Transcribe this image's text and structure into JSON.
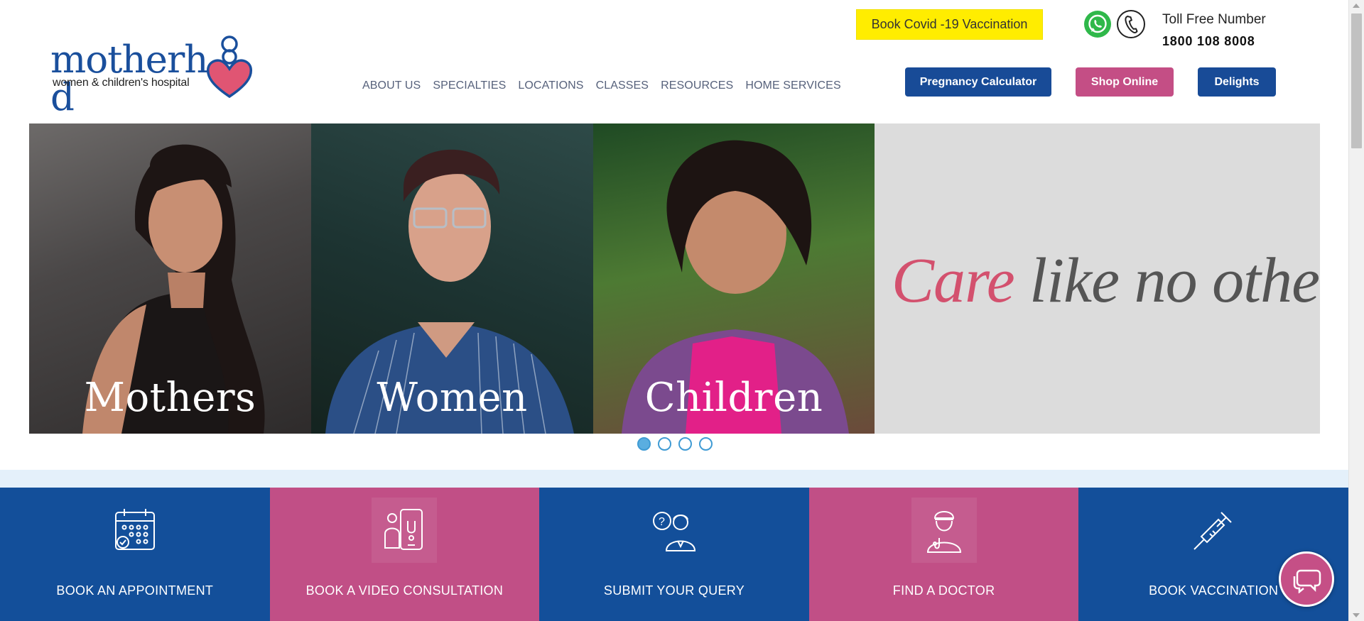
{
  "brand": {
    "wordmark": "motherhood",
    "wordmark_left": "motherh",
    "wordmark_right": "d",
    "subtitle": "women & children's hospital"
  },
  "nav": {
    "items": [
      "ABOUT US",
      "SPECIALTIES",
      "LOCATIONS",
      "CLASSES",
      "RESOURCES",
      "HOME SERVICES"
    ]
  },
  "header": {
    "covid_button": "Book Covid -19 Vaccination",
    "whatsapp_icon": "whatsapp-icon",
    "phone_icon": "phone-icon",
    "toll_free_label": "Toll Free Number",
    "toll_free_number": "1800 108 8008",
    "buttons": {
      "calculator": "Pregnancy Calculator",
      "shop": "Shop Online",
      "delights": "Delights"
    }
  },
  "hero": {
    "panels": [
      "Mothers",
      "Women",
      "Children"
    ],
    "tagline_accent": "Care",
    "tagline_rest": " like no other.",
    "slides_total": 4,
    "active_slide": 1
  },
  "tiles": [
    {
      "label": "BOOK AN APPOINTMENT",
      "icon": "calendar-icon",
      "color": "#134f9a"
    },
    {
      "label": "BOOK A VIDEO CONSULTATION",
      "icon": "video-consult-icon",
      "color": "#c14f86"
    },
    {
      "label": "SUBMIT YOUR QUERY",
      "icon": "query-icon",
      "color": "#134f9a"
    },
    {
      "label": "FIND A DOCTOR",
      "icon": "doctor-icon",
      "color": "#c14f86"
    },
    {
      "label": "BOOK VACCINATION",
      "icon": "syringe-icon",
      "color": "#134f9a"
    }
  ],
  "colors": {
    "brand_blue": "#184b97",
    "brand_pink": "#c44e85",
    "covid_yellow": "#ffed00"
  }
}
